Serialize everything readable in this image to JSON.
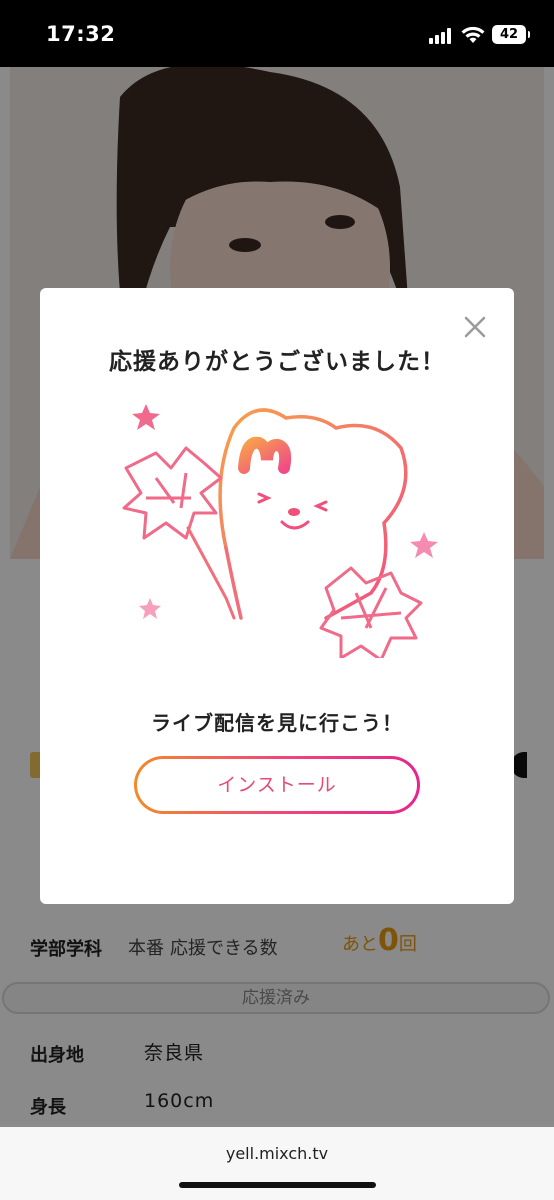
{
  "status_bar": {
    "time": "17:32",
    "battery": "42"
  },
  "profile": {
    "faculty_label": "学部学科",
    "faculty_value": "本番",
    "cheer_count_label": "応援できる数",
    "remaining_prefix": "あと",
    "remaining_count": "0",
    "remaining_suffix": "回",
    "cheered_button": "応援済み",
    "hometown_label": "出身地",
    "hometown_value": "奈良県",
    "height_label": "身長",
    "height_value": "160cm"
  },
  "modal": {
    "title": "応援ありがとうございました！",
    "subtitle": "ライブ配信を見に行こう！",
    "install_button": "インストール"
  },
  "browser": {
    "url": "yell.mixch.tv"
  },
  "colors": {
    "accent_orange": "#f28a2a",
    "accent_pink": "#e8238f",
    "remaining": "#e89b12"
  }
}
